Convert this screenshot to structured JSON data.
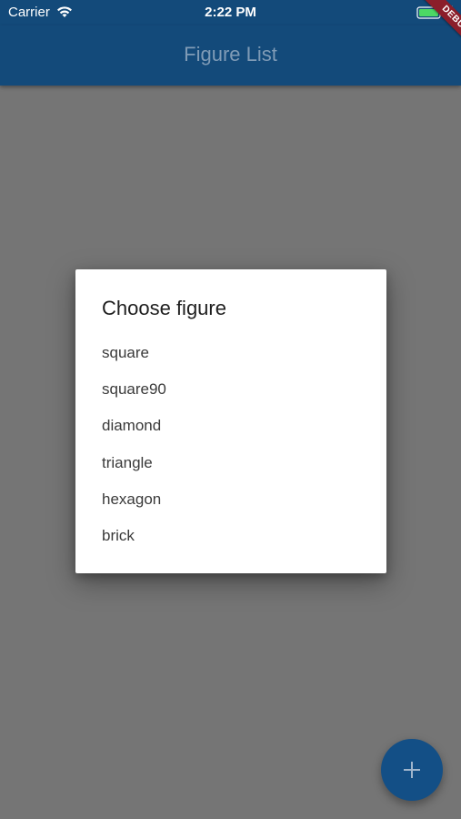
{
  "status_bar": {
    "carrier": "Carrier",
    "time": "2:22 PM",
    "wifi_icon": "wifi-icon",
    "battery_icon": "battery-icon",
    "charge_icon": "charging-bolt-icon"
  },
  "app_bar": {
    "title": "Figure List",
    "color": "#134a7a"
  },
  "debug_banner": {
    "label": "DEBUG",
    "color": "#8b1e2a"
  },
  "dialog": {
    "title": "Choose figure",
    "options": [
      "square",
      "square90",
      "diamond",
      "triangle",
      "hexagon",
      "brick"
    ]
  },
  "fab": {
    "icon": "plus-icon",
    "color": "#134f86"
  },
  "scrim_color": "#757575"
}
